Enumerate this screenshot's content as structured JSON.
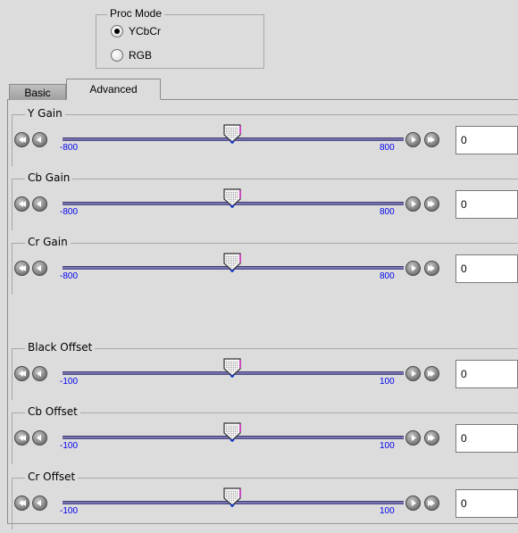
{
  "proc_mode": {
    "legend": "Proc Mode",
    "options": [
      {
        "label": "YCbCr",
        "selected": true
      },
      {
        "label": "RGB",
        "selected": false
      }
    ]
  },
  "tabs": [
    {
      "label": "Basic",
      "active": false
    },
    {
      "label": "Advanced",
      "active": true
    }
  ],
  "sliders": [
    {
      "label": "Y Gain",
      "min": "-800",
      "max": "800",
      "value": "0"
    },
    {
      "label": "Cb Gain",
      "min": "-800",
      "max": "800",
      "value": "0"
    },
    {
      "label": "Cr Gain",
      "min": "-800",
      "max": "800",
      "value": "0"
    },
    {
      "label": "Black Offset",
      "min": "-100",
      "max": "100",
      "value": "0"
    },
    {
      "label": "Cb Offset",
      "min": "-100",
      "max": "100",
      "value": "0"
    },
    {
      "label": "Cr Offset",
      "min": "-100",
      "max": "100",
      "value": "0"
    }
  ],
  "icons": {
    "fast_decrement": "fast-decrement-icon",
    "decrement": "decrement-icon",
    "increment": "increment-icon",
    "fast_increment": "fast-increment-icon",
    "thumb": "slider-thumb-icon"
  },
  "colors": {
    "track": "#5a58a0",
    "range_label": "#0000ee",
    "background": "#dcdcdc"
  }
}
